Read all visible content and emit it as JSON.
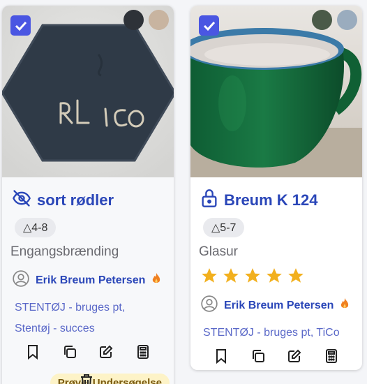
{
  "cards": [
    {
      "title": "sort rødler",
      "cone": "△4-8",
      "type": "Engangsbrænding",
      "author": "Erik Breum Petersen",
      "badge": "Prøve, Undersøgelse",
      "tags": [
        "STENTØJ - bruges pt,",
        "Stentøj - succes"
      ],
      "status_icon": "eye-off-icon",
      "selected": true,
      "swatch_colors": [
        "#2e3238",
        "#c8b4a0"
      ]
    },
    {
      "title": "Breum K 124",
      "cone": "△5-7",
      "type": "Glasur",
      "author": "Erik Breum Petersen",
      "rating": 5,
      "tags": [
        "STENTØJ - bruges pt, TiCo"
      ],
      "status_icon": "lock-icon",
      "selected": true,
      "swatch_colors": [
        "#4a5a48",
        "#9aacbe"
      ]
    }
  ],
  "colors": {
    "accent": "#4a56e2",
    "title": "#2a46b8",
    "star": "#f2b01e",
    "flame": "#f08020"
  }
}
